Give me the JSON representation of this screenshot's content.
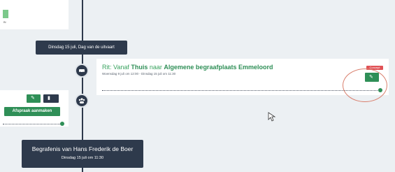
{
  "top_card": {
    "label": "Bi"
  },
  "timeline": {
    "date_header_1": "Dinsdag 15 juli, Dag van de uitvaart",
    "ride": {
      "prefix": "Rit: Vanaf",
      "from": "Thuis",
      "mid": "naar",
      "to": "Algemene begraafplaats Emmeloord",
      "subtitle": "Woensdag 9 juli om 12:00 - Dinsdag 15 juli om 11:30",
      "badge": "Concept"
    },
    "left_item": {
      "make_appointment": "Afspraak aanmaken"
    },
    "date_header_2": {
      "title": "Begrafenis van Hans Frederik de Boer",
      "subtitle": "Dinsdag 15 juli om 11:30"
    }
  },
  "colors": {
    "accent": "#2f8f57",
    "dark": "#2e3a4c",
    "badge": "#e05256"
  }
}
